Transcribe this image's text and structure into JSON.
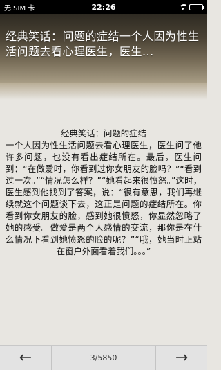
{
  "status_bar": {
    "carrier": "无 SIM 卡",
    "time": "22:26",
    "battery_level": 0.9
  },
  "header": {
    "title": "经典笑话：问题的症结一个人因为性生活问题去看心理医生，医生..."
  },
  "article": {
    "title": "经典笑话：问题的症结",
    "body": "一个人因为性生活问题去看心理医生，医生问了他许多问题，也没有看出症结所在。最后，医生问到：“在做爱时，你看到过你女朋友的脸吗？”“看到过一次。”“情况怎么样？”“她看起来很愤怒。”这时，医生感到他找到了答案，说：“很有意思，我们再继续就这个问题谈下去，这正是问题的症结所在。你看到你女朋友的脸，感到她很愤怒，你显然忽略了她的感受。做爱是两个人感情的交流，那你是在什么情况下看到她愤怒的脸的呢？”“哦，她当时正站在窗户外面看着我们。。。”"
  },
  "toolbar": {
    "prev_icon": "left-arrow-icon",
    "next_icon": "right-arrow-icon",
    "page_indicator": "3/5850",
    "prev_glyph": "←",
    "next_glyph": "→"
  }
}
